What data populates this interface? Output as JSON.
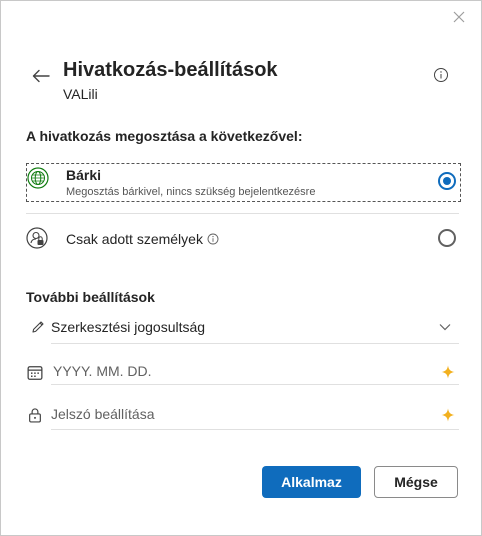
{
  "dialog": {
    "title": "Hivatkozás-beállítások",
    "subtitle": "VALili"
  },
  "share_section": {
    "label": "A hivatkozás megosztása a következővel:",
    "options": [
      {
        "title": "Bárki",
        "description": "Megosztás bárkivel, nincs szükség bejelentkezésre",
        "selected": true,
        "icon": "globe-icon"
      },
      {
        "title": "Csak adott személyek",
        "selected": false,
        "icon": "people-lock-icon"
      }
    ]
  },
  "more_section": {
    "label": "További beállítások",
    "permission": "Szerkesztési jogosultság",
    "date_placeholder": "YYYY. MM. DD.",
    "password_placeholder": "Jelszó beállítása"
  },
  "buttons": {
    "apply": "Alkalmaz",
    "cancel": "Mégse"
  },
  "colors": {
    "accent": "#0f6cbd",
    "sparkle": "#f2b01e",
    "globe": "#107c10"
  }
}
